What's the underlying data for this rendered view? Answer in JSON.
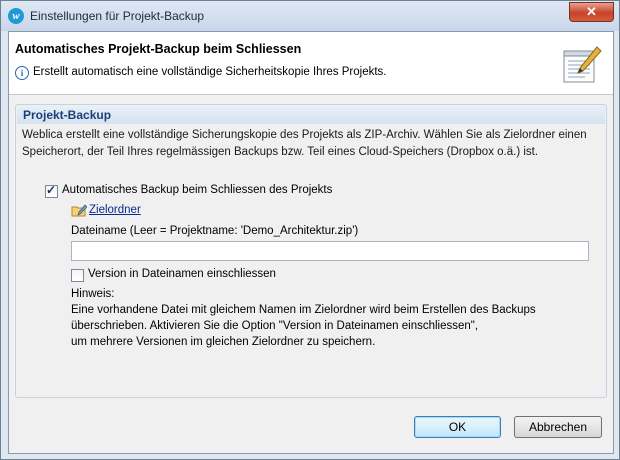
{
  "window": {
    "title": "Einstellungen für Projekt-Backup",
    "close_label": "✕"
  },
  "header": {
    "title": "Automatisches Projekt-Backup beim Schliessen",
    "description": "Erstellt automatisch eine vollständige Sicherheitskopie Ihres Projekts."
  },
  "group": {
    "title": "Projekt-Backup",
    "description": "Weblica erstellt eine vollständige Sicherungskopie des Projekts als ZIP-Archiv. Wählen Sie als Zielordner einen Speicherort, der Teil Ihres regelmässigen Backups bzw. Teil eines Cloud-Speichers (Dropbox o.ä.) ist."
  },
  "options": {
    "auto_backup_label": "Automatisches Backup beim Schliessen des Projekts",
    "auto_backup_checked": true,
    "target_folder_link": "Zielordner",
    "filename_label": "Dateiname (Leer = Projektname: 'Demo_Architektur.zip')",
    "filename_value": "",
    "version_label": "Version in Dateinamen einschliessen",
    "version_checked": false
  },
  "hint": {
    "title": "Hinweis:",
    "lines": [
      "Eine vorhandene Datei mit gleichem Namen im Zielordner wird beim Erstellen des Backups",
      "überschrieben. Aktivieren Sie die Option \"Version in Dateinamen einschliessen\",",
      "um mehrere Versionen im gleichen Zielordner zu speichern."
    ]
  },
  "buttons": {
    "ok": "OK",
    "cancel": "Abbrechen"
  }
}
